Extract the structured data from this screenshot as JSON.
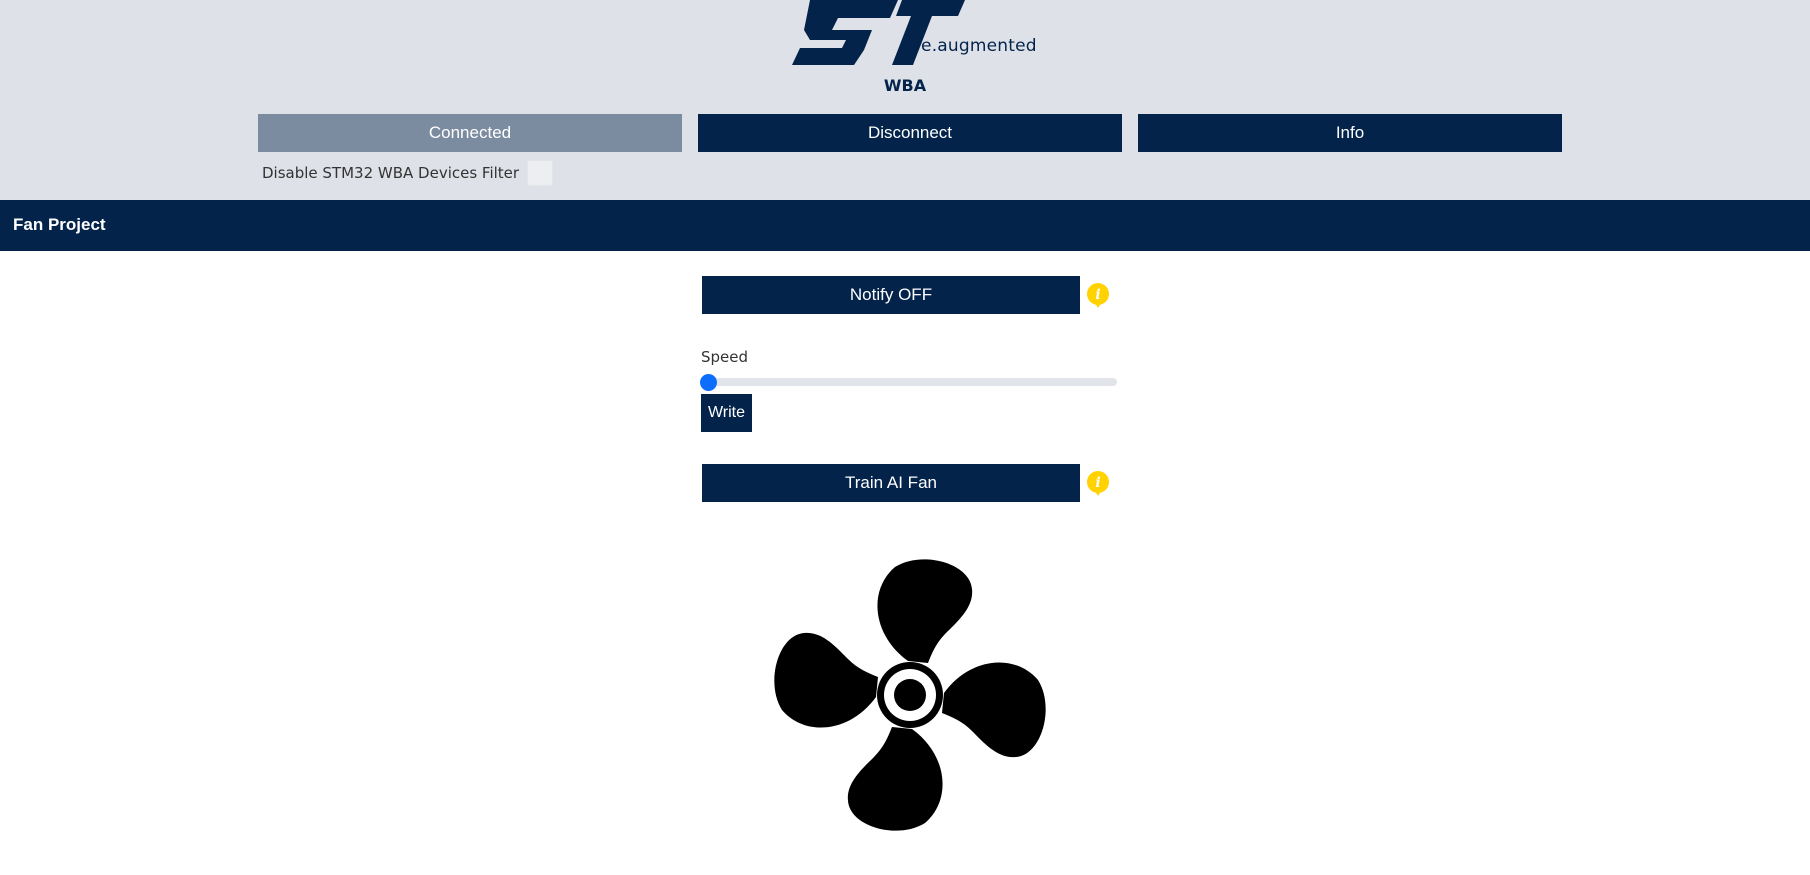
{
  "header": {
    "logo_tagline": "life.augmented",
    "device": "WBA",
    "buttons": {
      "connected": "Connected",
      "disconnect": "Disconnect",
      "info": "Info"
    },
    "filter_label": "Disable STM32 WBA Devices Filter"
  },
  "navbar": {
    "title": "Fan Project"
  },
  "main": {
    "notify_label": "Notify OFF",
    "speed_label": "Speed",
    "speed_value": 0,
    "write_label": "Write",
    "train_label": "Train AI Fan"
  },
  "colors": {
    "brand": "#03234b",
    "connected": "#7b8ca1",
    "header_bg": "#dee1e7",
    "slider_thumb": "#0d6efd",
    "info_icon": "#ffd200"
  },
  "icons": [
    "st-logo",
    "info-icon",
    "fan-icon"
  ]
}
